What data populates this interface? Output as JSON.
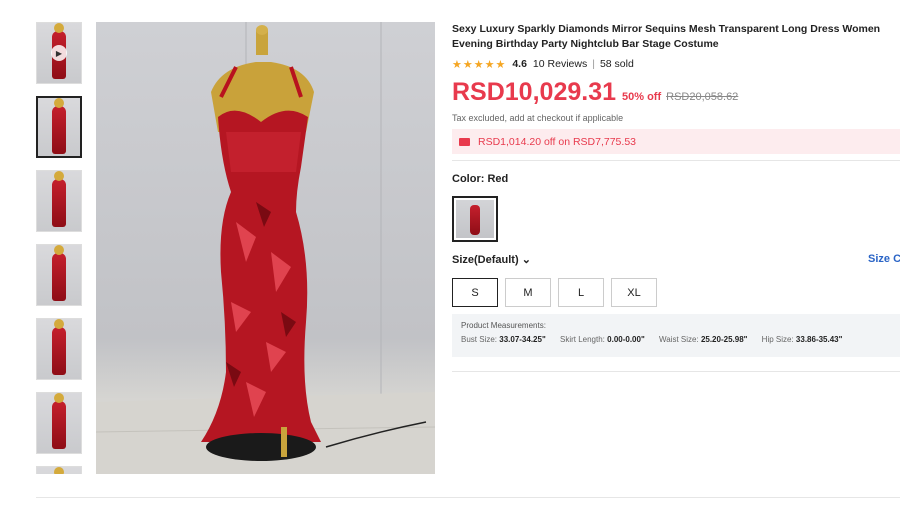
{
  "product": {
    "title": "Sexy Luxury Sparkly Diamonds Mirror Sequins Mesh Transparent Long Dress Women Evening Birthday Party Nightclub Bar Stage Costume",
    "rating_stars": "★★★★★",
    "rating_value": "4.6",
    "reviews": "10 Reviews",
    "separator": "|",
    "sold": "58 sold",
    "price": "RSD10,029.31",
    "discount": "50% off",
    "original_price": "RSD20,058.62",
    "tax_note": "Tax excluded, add at checkout if applicable",
    "coupon": "RSD1,014.20 off on RSD7,775.53"
  },
  "color": {
    "label": "Color: Red"
  },
  "size": {
    "label": "Size(Default)",
    "chevron": "⌄",
    "chart_link": "Size C",
    "options": [
      "S",
      "M",
      "L",
      "XL"
    ],
    "selected": "S"
  },
  "measurements": {
    "heading": "Product Measurements:",
    "bust_label": "Bust Size:",
    "bust_value": "33.07-34.25\"",
    "skirt_label": "Skirt Length:",
    "skirt_value": "0.00-0.00\"",
    "waist_label": "Waist Size:",
    "waist_value": "25.20-25.98\"",
    "hip_label": "Hip Size:",
    "hip_value": "33.86-35.43\""
  },
  "colors": {
    "accent": "#e83a4d",
    "link": "#2a64c6",
    "star": "#f5a623"
  },
  "icons": {
    "play": "play-icon",
    "coupon": "coupon-icon"
  }
}
